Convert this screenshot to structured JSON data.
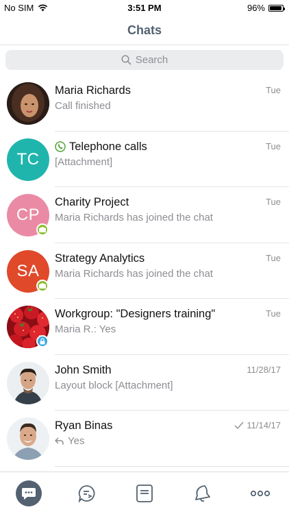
{
  "status_bar": {
    "carrier": "No SIM",
    "time": "3:51 PM",
    "battery": "96%",
    "battery_level": 0.96
  },
  "header": {
    "title": "Chats"
  },
  "search": {
    "placeholder": "Search"
  },
  "chats": [
    {
      "name": "Maria Richards",
      "preview": "Call finished",
      "date": "Tue",
      "avatar_type": "photo",
      "avatar_icon": "woman-portrait"
    },
    {
      "name": "Telephone calls",
      "preview": "[Attachment]",
      "date": "Tue",
      "avatar_initials": "TC",
      "avatar_color": "#20b5ac",
      "name_icon": "phone-icon"
    },
    {
      "name": "Charity Project",
      "preview": "Maria Richards has joined the chat",
      "date": "Tue",
      "avatar_initials": "CP",
      "avatar_color": "#ea8aa4",
      "badge_icon": "group-chat-badge"
    },
    {
      "name": "Strategy Analytics",
      "preview": "Maria Richards has joined the chat",
      "date": "Tue",
      "avatar_initials": "SA",
      "avatar_color": "#e0492a",
      "badge_icon": "group-chat-badge"
    },
    {
      "name": "Workgroup: \"Designers training\"",
      "preview": "Maria R.: Yes",
      "date": "Tue",
      "avatar_type": "photo",
      "avatar_icon": "strawberries",
      "badge_icon": "lock-badge"
    },
    {
      "name": "John Smith",
      "preview": "Layout block [Attachment]",
      "date": "11/28/17",
      "avatar_type": "photo",
      "avatar_icon": "man-portrait"
    },
    {
      "name": "Ryan Binas",
      "preview": "Yes",
      "date": "11/14/17",
      "avatar_type": "photo",
      "avatar_icon": "smiling-man-portrait",
      "status_icon": "check-icon",
      "preview_icon": "reply-icon"
    }
  ],
  "tab_bar": [
    "chats-tab",
    "open-lines-tab",
    "notes-tab",
    "notifications-tab",
    "more-tab"
  ],
  "colors": {
    "accent": "#536170",
    "muted_text": "#8d8d93",
    "badge_green": "#8cbd2f",
    "badge_blue": "#36a7df",
    "phone_green": "#52a535"
  }
}
